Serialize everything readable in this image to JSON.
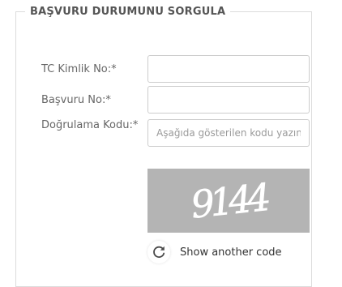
{
  "form": {
    "legend": "BAŞVURU DURUMUNU SORGULA",
    "fields": {
      "tc_label": "TC Kimlik No:*",
      "tc_value": "",
      "basvuru_label": "Başvuru No:*",
      "basvuru_value": "",
      "dogrulama_label": "Doğrulama Kodu:*",
      "dogrulama_value": "",
      "dogrulama_placeholder": "Aşağıda gösterilen kodu yazın"
    },
    "captcha": {
      "code": "9144",
      "background_color": "#b4b4b4"
    },
    "refresh": {
      "label": "Show another code",
      "icon": "refresh-icon"
    }
  }
}
